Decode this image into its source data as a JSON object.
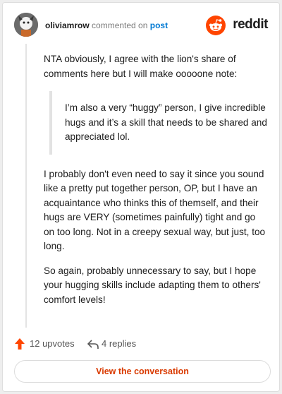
{
  "header": {
    "username": "oliviamrow",
    "action_text": "commented on",
    "post_link": "post",
    "brand": "reddit"
  },
  "comment": {
    "intro": "NTA obviously, I agree with the lion's share of comments here but I will make ooooone note:",
    "quote": "I’m also a very “huggy” person, I give incredible hugs and it’s a skill that needs to be shared and appreciated lol.",
    "paragraph_1": "I probably don't even need to say it since you sound like a pretty put together person, OP, but I have an acquaintance who thinks this of themself, and their hugs are VERY (sometimes painfully) tight and go on too long. Not in a creepy sexual way, but just, too long.",
    "paragraph_2": "So again, probably unnecessary to say, but I hope your hugging skills include adapting them to others' comfort levels!"
  },
  "footer": {
    "upvotes": "12 upvotes",
    "replies": "4 replies",
    "cta": "View the conversation"
  },
  "colors": {
    "accent": "#ff4500",
    "link": "#0079d3",
    "cta_text": "#d93a00"
  },
  "icons": {
    "avatar": "avatar",
    "brand": "reddit-logo-icon",
    "upvote": "upvote-arrow-icon",
    "reply": "reply-icon"
  }
}
